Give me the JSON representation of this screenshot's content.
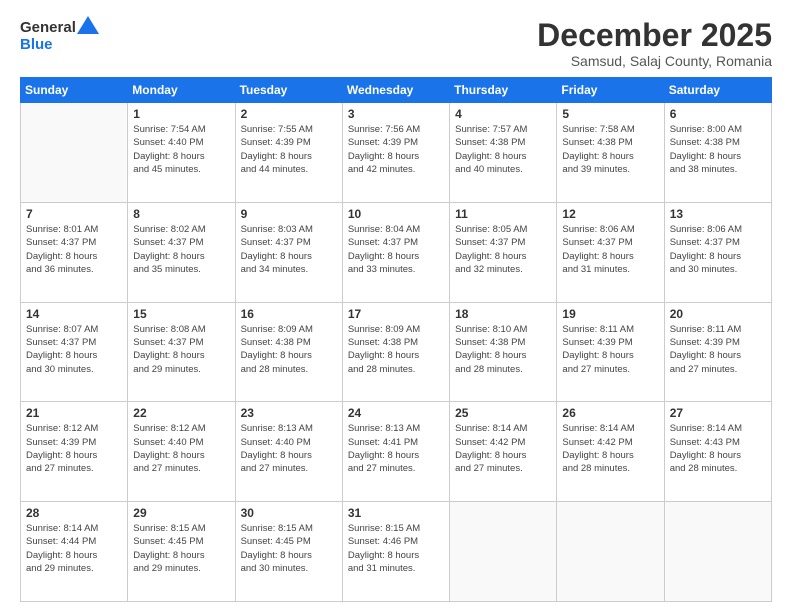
{
  "header": {
    "logo_general": "General",
    "logo_blue": "Blue",
    "month": "December 2025",
    "location": "Samsud, Salaj County, Romania"
  },
  "weekdays": [
    "Sunday",
    "Monday",
    "Tuesday",
    "Wednesday",
    "Thursday",
    "Friday",
    "Saturday"
  ],
  "weeks": [
    [
      {
        "day": "",
        "info": ""
      },
      {
        "day": "1",
        "info": "Sunrise: 7:54 AM\nSunset: 4:40 PM\nDaylight: 8 hours\nand 45 minutes."
      },
      {
        "day": "2",
        "info": "Sunrise: 7:55 AM\nSunset: 4:39 PM\nDaylight: 8 hours\nand 44 minutes."
      },
      {
        "day": "3",
        "info": "Sunrise: 7:56 AM\nSunset: 4:39 PM\nDaylight: 8 hours\nand 42 minutes."
      },
      {
        "day": "4",
        "info": "Sunrise: 7:57 AM\nSunset: 4:38 PM\nDaylight: 8 hours\nand 40 minutes."
      },
      {
        "day": "5",
        "info": "Sunrise: 7:58 AM\nSunset: 4:38 PM\nDaylight: 8 hours\nand 39 minutes."
      },
      {
        "day": "6",
        "info": "Sunrise: 8:00 AM\nSunset: 4:38 PM\nDaylight: 8 hours\nand 38 minutes."
      }
    ],
    [
      {
        "day": "7",
        "info": "Sunrise: 8:01 AM\nSunset: 4:37 PM\nDaylight: 8 hours\nand 36 minutes."
      },
      {
        "day": "8",
        "info": "Sunrise: 8:02 AM\nSunset: 4:37 PM\nDaylight: 8 hours\nand 35 minutes."
      },
      {
        "day": "9",
        "info": "Sunrise: 8:03 AM\nSunset: 4:37 PM\nDaylight: 8 hours\nand 34 minutes."
      },
      {
        "day": "10",
        "info": "Sunrise: 8:04 AM\nSunset: 4:37 PM\nDaylight: 8 hours\nand 33 minutes."
      },
      {
        "day": "11",
        "info": "Sunrise: 8:05 AM\nSunset: 4:37 PM\nDaylight: 8 hours\nand 32 minutes."
      },
      {
        "day": "12",
        "info": "Sunrise: 8:06 AM\nSunset: 4:37 PM\nDaylight: 8 hours\nand 31 minutes."
      },
      {
        "day": "13",
        "info": "Sunrise: 8:06 AM\nSunset: 4:37 PM\nDaylight: 8 hours\nand 30 minutes."
      }
    ],
    [
      {
        "day": "14",
        "info": "Sunrise: 8:07 AM\nSunset: 4:37 PM\nDaylight: 8 hours\nand 30 minutes."
      },
      {
        "day": "15",
        "info": "Sunrise: 8:08 AM\nSunset: 4:37 PM\nDaylight: 8 hours\nand 29 minutes."
      },
      {
        "day": "16",
        "info": "Sunrise: 8:09 AM\nSunset: 4:38 PM\nDaylight: 8 hours\nand 28 minutes."
      },
      {
        "day": "17",
        "info": "Sunrise: 8:09 AM\nSunset: 4:38 PM\nDaylight: 8 hours\nand 28 minutes."
      },
      {
        "day": "18",
        "info": "Sunrise: 8:10 AM\nSunset: 4:38 PM\nDaylight: 8 hours\nand 28 minutes."
      },
      {
        "day": "19",
        "info": "Sunrise: 8:11 AM\nSunset: 4:39 PM\nDaylight: 8 hours\nand 27 minutes."
      },
      {
        "day": "20",
        "info": "Sunrise: 8:11 AM\nSunset: 4:39 PM\nDaylight: 8 hours\nand 27 minutes."
      }
    ],
    [
      {
        "day": "21",
        "info": "Sunrise: 8:12 AM\nSunset: 4:39 PM\nDaylight: 8 hours\nand 27 minutes."
      },
      {
        "day": "22",
        "info": "Sunrise: 8:12 AM\nSunset: 4:40 PM\nDaylight: 8 hours\nand 27 minutes."
      },
      {
        "day": "23",
        "info": "Sunrise: 8:13 AM\nSunset: 4:40 PM\nDaylight: 8 hours\nand 27 minutes."
      },
      {
        "day": "24",
        "info": "Sunrise: 8:13 AM\nSunset: 4:41 PM\nDaylight: 8 hours\nand 27 minutes."
      },
      {
        "day": "25",
        "info": "Sunrise: 8:14 AM\nSunset: 4:42 PM\nDaylight: 8 hours\nand 27 minutes."
      },
      {
        "day": "26",
        "info": "Sunrise: 8:14 AM\nSunset: 4:42 PM\nDaylight: 8 hours\nand 28 minutes."
      },
      {
        "day": "27",
        "info": "Sunrise: 8:14 AM\nSunset: 4:43 PM\nDaylight: 8 hours\nand 28 minutes."
      }
    ],
    [
      {
        "day": "28",
        "info": "Sunrise: 8:14 AM\nSunset: 4:44 PM\nDaylight: 8 hours\nand 29 minutes."
      },
      {
        "day": "29",
        "info": "Sunrise: 8:15 AM\nSunset: 4:45 PM\nDaylight: 8 hours\nand 29 minutes."
      },
      {
        "day": "30",
        "info": "Sunrise: 8:15 AM\nSunset: 4:45 PM\nDaylight: 8 hours\nand 30 minutes."
      },
      {
        "day": "31",
        "info": "Sunrise: 8:15 AM\nSunset: 4:46 PM\nDaylight: 8 hours\nand 31 minutes."
      },
      {
        "day": "",
        "info": ""
      },
      {
        "day": "",
        "info": ""
      },
      {
        "day": "",
        "info": ""
      }
    ]
  ]
}
